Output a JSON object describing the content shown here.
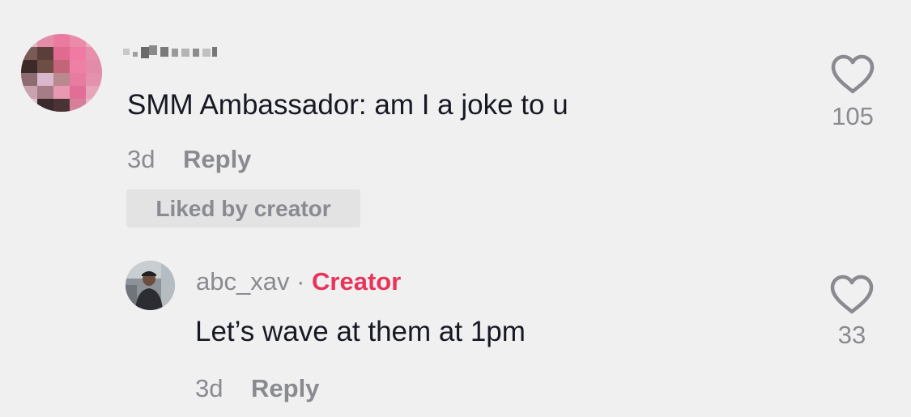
{
  "comment": {
    "text": "SMM Ambassador: am I a joke to u",
    "time": "3d",
    "reply_label": "Reply",
    "liked_badge": "Liked by creator",
    "like_count": "105",
    "like_icon": "heart-outline-icon"
  },
  "reply": {
    "username": "abc_xav",
    "separator": "·",
    "creator_label": "Creator",
    "text": "Let’s wave at them at 1pm",
    "time": "3d",
    "reply_label": "Reply",
    "like_count": "33",
    "like_icon": "heart-outline-icon"
  },
  "colors": {
    "background": "#f0f0f0",
    "text_primary": "#161823",
    "text_secondary": "#8a8b91",
    "creator_accent": "#e8335a",
    "badge_bg": "#e3e3e4"
  }
}
